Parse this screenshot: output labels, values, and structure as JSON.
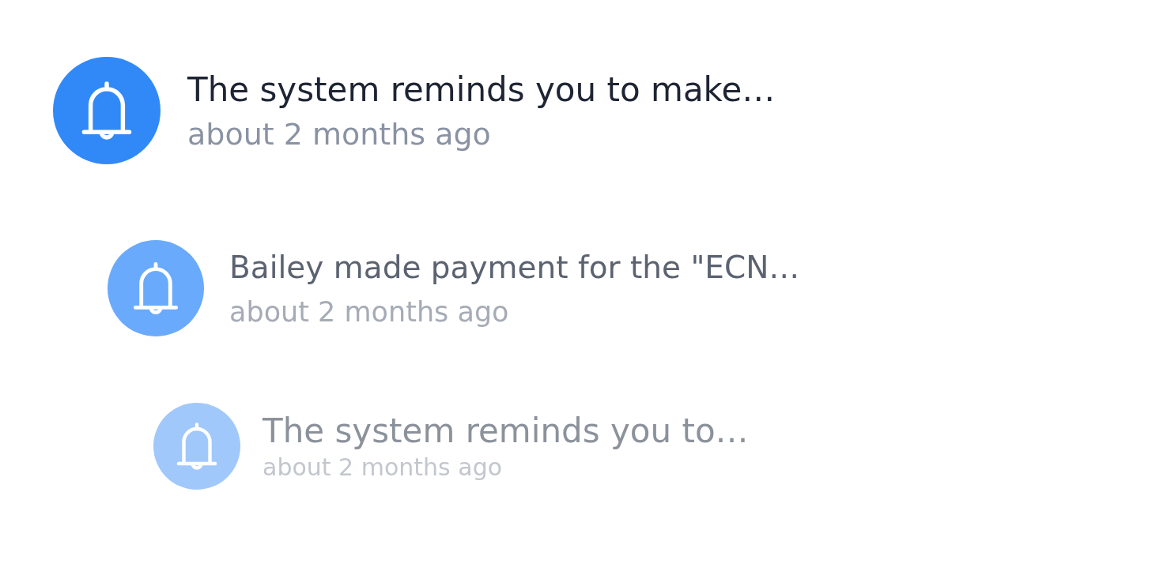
{
  "notifications": [
    {
      "kind": "front",
      "title": "The system reminds you to make…",
      "time": "about 2 months ago"
    },
    {
      "kind": "middle",
      "title": "Bailey made payment for the \"ECN…",
      "time": "about 2 months ago"
    },
    {
      "kind": "back",
      "title": "The system reminds you to…",
      "time": "about 2 months ago"
    }
  ]
}
